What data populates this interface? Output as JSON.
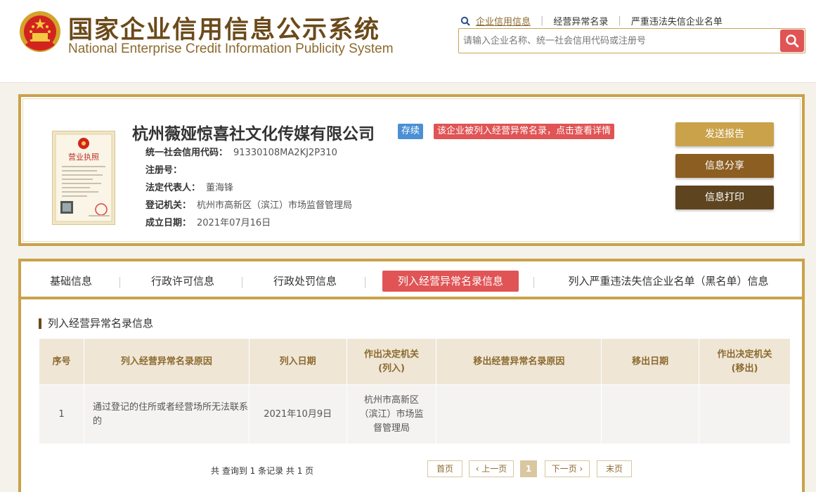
{
  "header": {
    "title_cn": "国家企业信用信息公示系统",
    "title_en": "National Enterprise Credit Information Publicity System",
    "links": [
      "企业信用信息",
      "经营异常名录",
      "严重违法失信企业名单"
    ],
    "search_placeholder": "请输入企业名称、统一社会信用代码或注册号"
  },
  "company": {
    "name": "杭州薇娅惊喜社文化传媒有限公司",
    "status": "存续",
    "warning": "该企业被列入经营异常名录，点击查看详情",
    "fields": [
      {
        "label": "统一社会信用代码：",
        "value": "91330108MA2KJ2P310"
      },
      {
        "label": "注册号：",
        "value": ""
      },
      {
        "label": "法定代表人：",
        "value": "董海锋"
      },
      {
        "label": "登记机关：",
        "value": "杭州市高新区（滨江）市场监督管理局"
      },
      {
        "label": "成立日期：",
        "value": "2021年07月16日"
      }
    ],
    "license_label": "营业执照",
    "buttons": {
      "send_report": "发送报告",
      "share": "信息分享",
      "print": "信息打印"
    }
  },
  "tabs": {
    "basic": "基础信息",
    "permit": "行政许可信息",
    "penalty": "行政处罚信息",
    "abnormal": "列入经营异常名录信息",
    "blacklist": "列入严重违法失信企业名单（黑名单）信息"
  },
  "section_title": "列入经营异常名录信息",
  "table": {
    "headers": [
      "序号",
      "列入经营异常名录原因",
      "列入日期",
      "作出决定机关\n(列入)",
      "移出经营异常名录原因",
      "移出日期",
      "作出决定机关\n(移出)"
    ],
    "rows": [
      [
        "1",
        "通过登记的住所或者经营场所无法联系的",
        "2021年10月9日",
        "杭州市高新区（滨江）市场监督管理局",
        "",
        "",
        ""
      ]
    ]
  },
  "pager": {
    "info": "共 查询到 1 条记录 共 1 页",
    "first": "首页",
    "prev": "‹ 上一页",
    "current": "1",
    "next": "下一页 ›",
    "last": "末页"
  },
  "colors": {
    "gold": "#c9a24a",
    "red": "#e05455",
    "blue": "#4b8fd4",
    "brown": "#6b4a1a"
  }
}
